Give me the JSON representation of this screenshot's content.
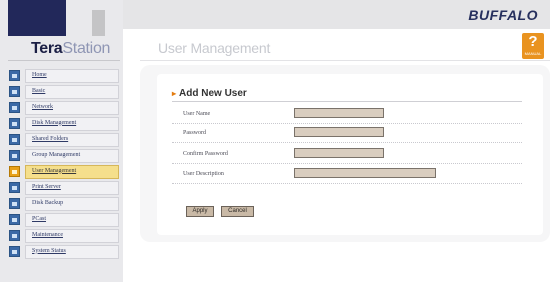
{
  "app": {
    "logo_bold": "Tera",
    "logo_light": "Station",
    "brand": "BUFFALO"
  },
  "header": {
    "page_title": "User Management",
    "help_mark": "?",
    "help_label": "MANUAL"
  },
  "sidebar": {
    "items": [
      {
        "label": "Home",
        "active": false
      },
      {
        "label": "Basic",
        "active": false
      },
      {
        "label": "Network",
        "active": false
      },
      {
        "label": "Disk Management",
        "active": false
      },
      {
        "label": "Shared Folders",
        "active": false
      },
      {
        "label": "Group Management",
        "active": false
      },
      {
        "label": "User Management",
        "active": true
      },
      {
        "label": "Print Server",
        "active": false
      },
      {
        "label": "Disk Backup",
        "active": false
      },
      {
        "label": "PCast",
        "active": false
      },
      {
        "label": "Maintenance",
        "active": false
      },
      {
        "label": "System Status",
        "active": false
      }
    ]
  },
  "form": {
    "section_title": "Add New User",
    "fields": {
      "user_name": {
        "label": "User Name",
        "value": ""
      },
      "password": {
        "label": "Password",
        "value": ""
      },
      "confirm_password": {
        "label": "Confirm Password",
        "value": ""
      },
      "user_description": {
        "label": "User Description",
        "value": ""
      }
    },
    "apply_label": "Apply",
    "cancel_label": "Cancel"
  },
  "colors": {
    "brand_navy": "#22285a",
    "accent_orange": "#e99320",
    "active_item": "#f5df8c",
    "input_fill": "#d9cdbf"
  }
}
